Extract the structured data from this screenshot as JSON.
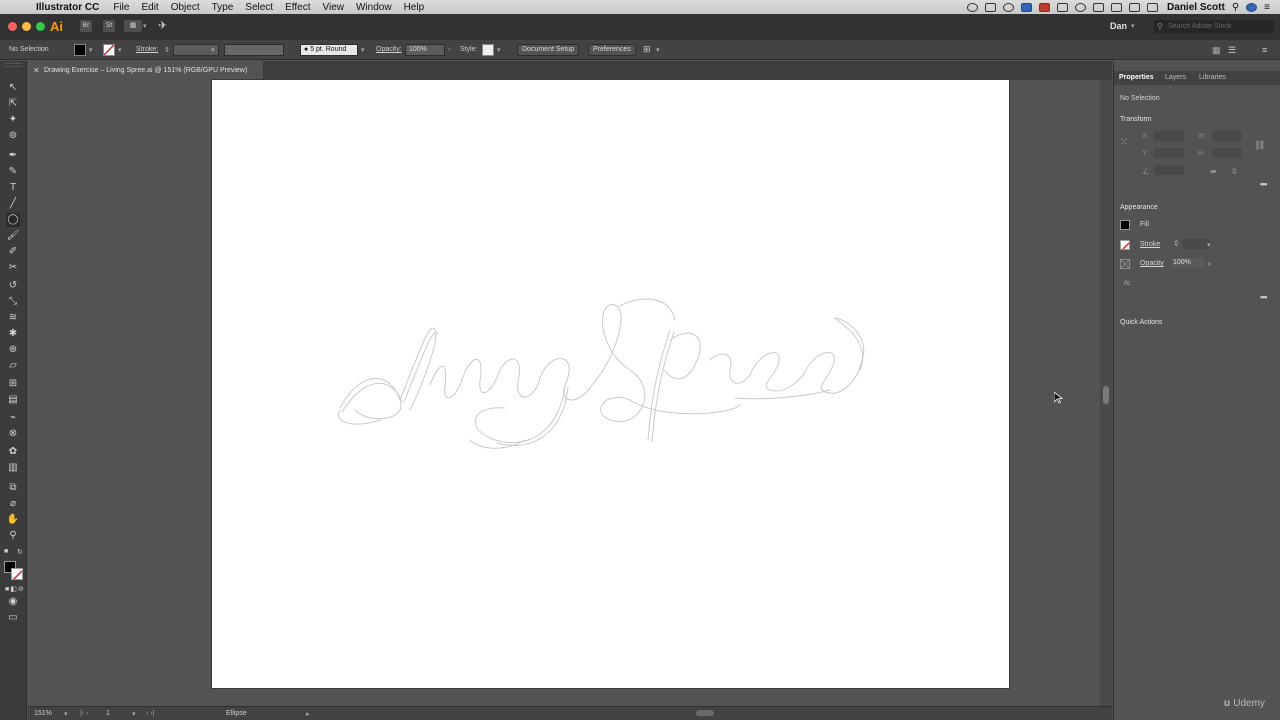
{
  "menubar": {
    "app_name": "Illustrator CC",
    "items": [
      "File",
      "Edit",
      "Object",
      "Type",
      "Select",
      "Effect",
      "View",
      "Window",
      "Help"
    ],
    "user_name": "Daniel Scott"
  },
  "appbar": {
    "logo": "Ai",
    "br_label": "Br",
    "st_label": "St",
    "workspace": "Dan",
    "search_placeholder": "Search Adobe Stock"
  },
  "controlbar": {
    "selection": "No Selection",
    "stroke_label": "Stroke:",
    "brush": "5 pt. Round",
    "opacity_label": "Opacity:",
    "opacity_value": "100%",
    "style_label": "Style:",
    "document_setup": "Document Setup",
    "preferences": "Preferences"
  },
  "document": {
    "tab_title": "Drawing Exercise – Living Spree.ai @ 151% (RGB/GPU Preview)"
  },
  "statusbar": {
    "zoom": "151%",
    "artboard": "1",
    "tool": "Ellipse"
  },
  "properties": {
    "tabs": [
      "Properties",
      "Layers",
      "Libraries"
    ],
    "selection": "No Selection",
    "transform": {
      "title": "Transform",
      "x_label": "X:",
      "y_label": "Y:",
      "w_label": "W:",
      "h_label": "H:"
    },
    "appearance": {
      "title": "Appearance",
      "fill_label": "Fill",
      "stroke_label": "Stroke",
      "opacity_label": "Opacity",
      "opacity_value": "100%",
      "fx_label": "fx."
    },
    "quick_actions": "Quick Actions"
  },
  "watermark": "Udemy",
  "colors": {
    "accent_orange": "#ff9a00",
    "panel_dark": "#323232",
    "panel_mid": "#535353",
    "artboard": "#ffffff"
  }
}
